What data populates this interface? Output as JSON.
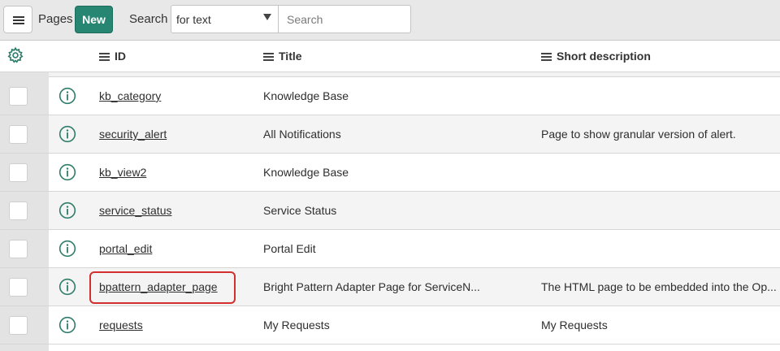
{
  "toolbar": {
    "pages_label": "Pages",
    "new_label": "New",
    "search_label": "Search",
    "search_field_selected": "for text",
    "search_placeholder": "Search"
  },
  "columns": {
    "id": "ID",
    "title": "Title",
    "short_description": "Short description"
  },
  "rows": [
    {
      "id": "kb_category",
      "title": "Knowledge Base",
      "short_description": ""
    },
    {
      "id": "security_alert",
      "title": "All Notifications",
      "short_description": "Page to show granular version of alert."
    },
    {
      "id": "kb_view2",
      "title": "Knowledge Base",
      "short_description": ""
    },
    {
      "id": "service_status",
      "title": "Service Status",
      "short_description": ""
    },
    {
      "id": "portal_edit",
      "title": "Portal Edit",
      "short_description": ""
    },
    {
      "id": "bpattern_adapter_page",
      "title": "Bright Pattern Adapter Page for ServiceN...",
      "short_description": "The HTML page to be embedded into the Op..."
    },
    {
      "id": "requests",
      "title": "My Requests",
      "short_description": "My Requests"
    }
  ],
  "colors": {
    "accent": "#278672",
    "icon": "#2e7d6b",
    "highlight": "#d32f2f"
  },
  "icons": {
    "menu": "hamburger-icon",
    "settings": "gear-icon",
    "info": "info-circle-icon",
    "column_menu": "column-menu-icon"
  }
}
